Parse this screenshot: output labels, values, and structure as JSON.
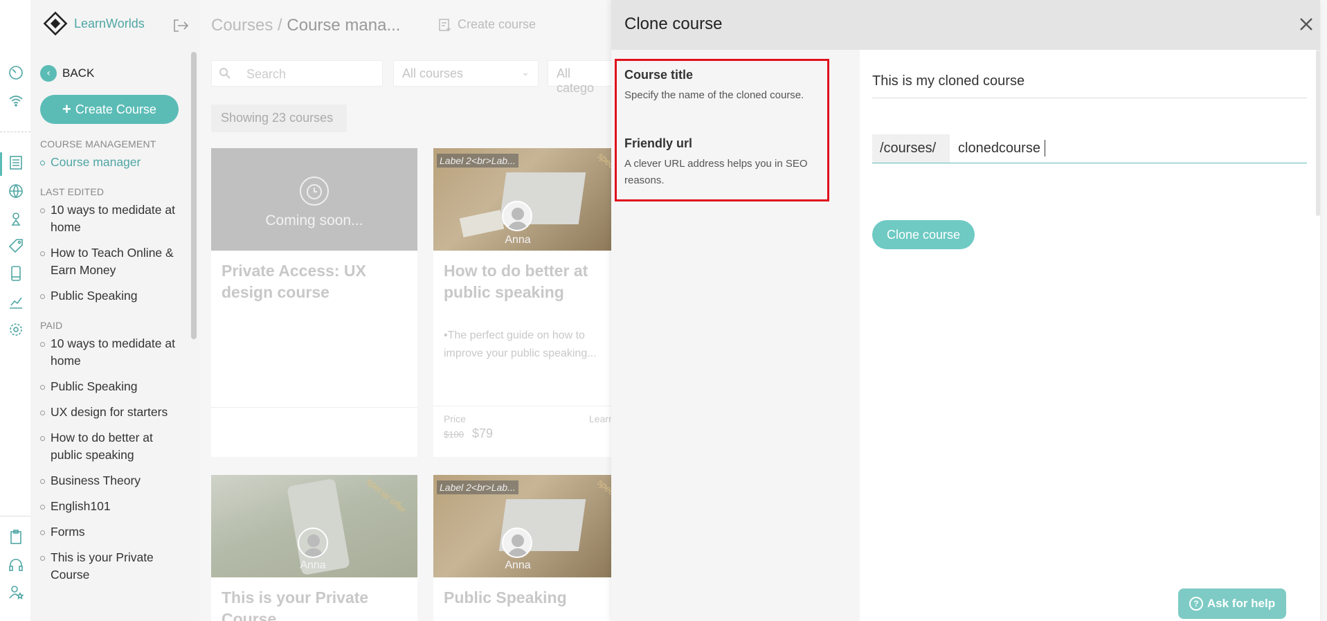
{
  "brand": {
    "name": "LearnWorlds"
  },
  "sidebar": {
    "back_label": "BACK",
    "create_label": "Create Course",
    "sections": [
      {
        "heading": "COURSE MANAGEMENT",
        "items": [
          "Course manager"
        ]
      },
      {
        "heading": "LAST EDITED",
        "items": [
          "10 ways to medidate at home",
          "How to Teach Online & Earn Money",
          "Public Speaking"
        ]
      },
      {
        "heading": "PAID",
        "items": [
          "10 ways to medidate at home",
          "Public Speaking",
          "UX design for starters",
          "How to do better at public speaking",
          "Business Theory",
          "English101",
          "Forms",
          "This is your Private Course"
        ]
      }
    ]
  },
  "main": {
    "breadcrumb_root": "Courses",
    "breadcrumb_sep": " / ",
    "breadcrumb_current": "Course mana...",
    "create_course_label": "Create course",
    "search_placeholder": "Search",
    "filter_courses": "All courses",
    "filter_categories": "All catego",
    "showing": "Showing 23 courses",
    "cards": [
      {
        "title": "Private Access: UX design course",
        "coming_soon": "Coming soon..."
      },
      {
        "title": "How to do better at public speaking",
        "label": "Label 2<br>Lab...",
        "ribbon": "spec",
        "author": "Anna",
        "desc": "•The perfect guide on how to improve your public speaking...",
        "price_label": "Price",
        "price_old": "$100",
        "price_new": "$79",
        "learn": "Learn"
      },
      {
        "title": "This is your Private Course",
        "ribbon": "special offer",
        "author": "Anna"
      },
      {
        "title": "Public Speaking",
        "label": "Label 2<br>Lab...",
        "ribbon": "spec",
        "author": "Anna"
      }
    ]
  },
  "panel": {
    "title": "Clone course",
    "fields": [
      {
        "label": "Course title",
        "desc": "Specify the name of the cloned course."
      },
      {
        "label": "Friendly url",
        "desc": "A clever URL address helps you in SEO reasons."
      }
    ],
    "title_value": "This is my cloned course",
    "url_prefix": "/courses/",
    "url_value": "clonedcourse",
    "clone_button": "Clone course"
  },
  "help": {
    "label": "Ask for help"
  },
  "colors": {
    "accent": "#5bbcb6",
    "highlight": "#e0101c"
  }
}
